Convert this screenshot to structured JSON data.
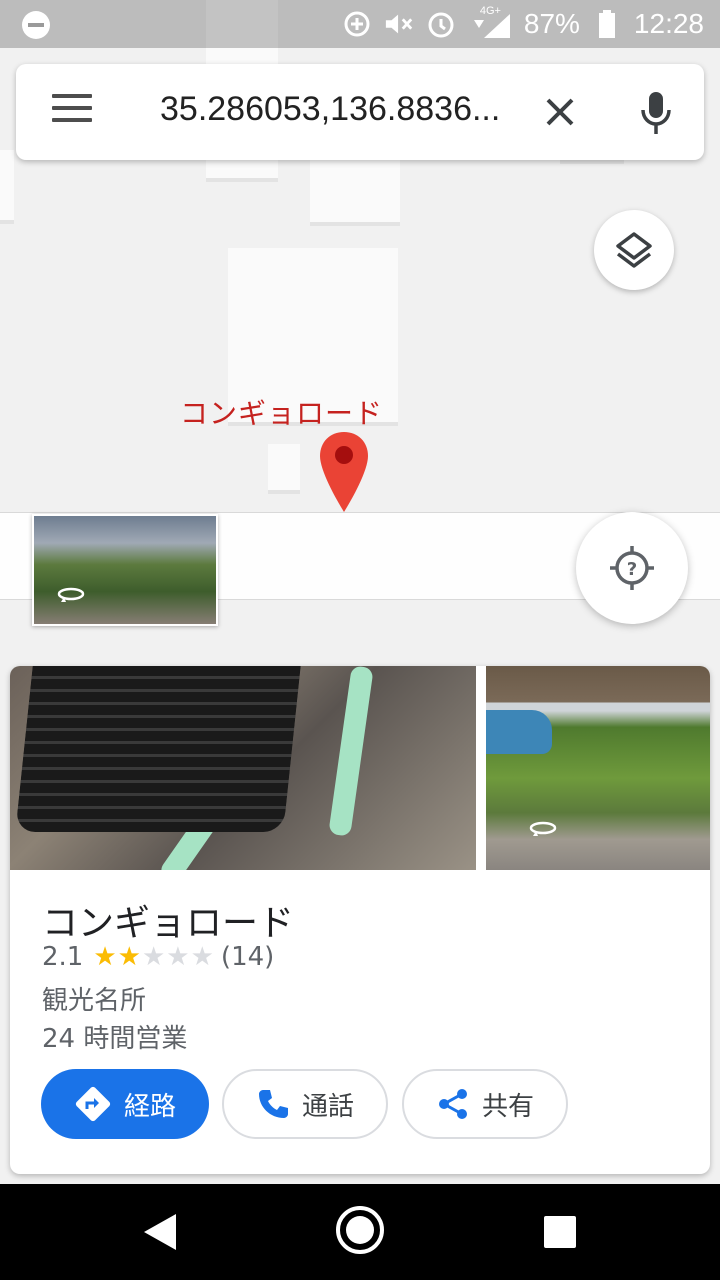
{
  "status_bar": {
    "battery": "87%",
    "time": "12:28",
    "network": "4G+"
  },
  "search": {
    "query": "35.286053,136.8836..."
  },
  "map": {
    "label": "コンギョロード"
  },
  "place": {
    "name": "コンギョロード",
    "rating": "2.1",
    "stars_filled": 2,
    "stars_total": 5,
    "review_count": "(14)",
    "category": "観光名所",
    "hours": "24 時間営業"
  },
  "actions": {
    "directions": "経路",
    "call": "通話",
    "share": "共有"
  },
  "colors": {
    "accent": "#1a73e8",
    "pin": "#ea4335",
    "label": "#c5221f",
    "star": "#fbbc04"
  },
  "icons": [
    "menu-icon",
    "close-icon",
    "mic-icon",
    "layers-icon",
    "my-location-icon",
    "street-view-rotate-icon",
    "directions-icon",
    "phone-icon",
    "share-icon"
  ]
}
